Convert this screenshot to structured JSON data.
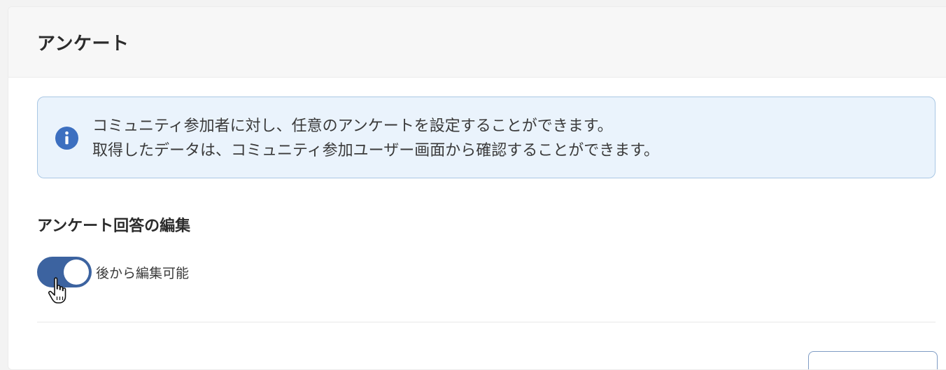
{
  "card": {
    "title": "アンケート"
  },
  "info": {
    "icon": "info-icon",
    "line1": "コミュニティ参加者に対し、任意のアンケートを設定することができます。",
    "line2": "取得したデータは、コミュニティ参加ユーザー画面から確認することができます。"
  },
  "section": {
    "title": "アンケート回答の編集"
  },
  "toggle": {
    "label": "後から編集可能",
    "checked": true
  },
  "colors": {
    "accent": "#3c63a0",
    "info_background": "#eaf3fc",
    "info_border": "#a9c7e4"
  }
}
